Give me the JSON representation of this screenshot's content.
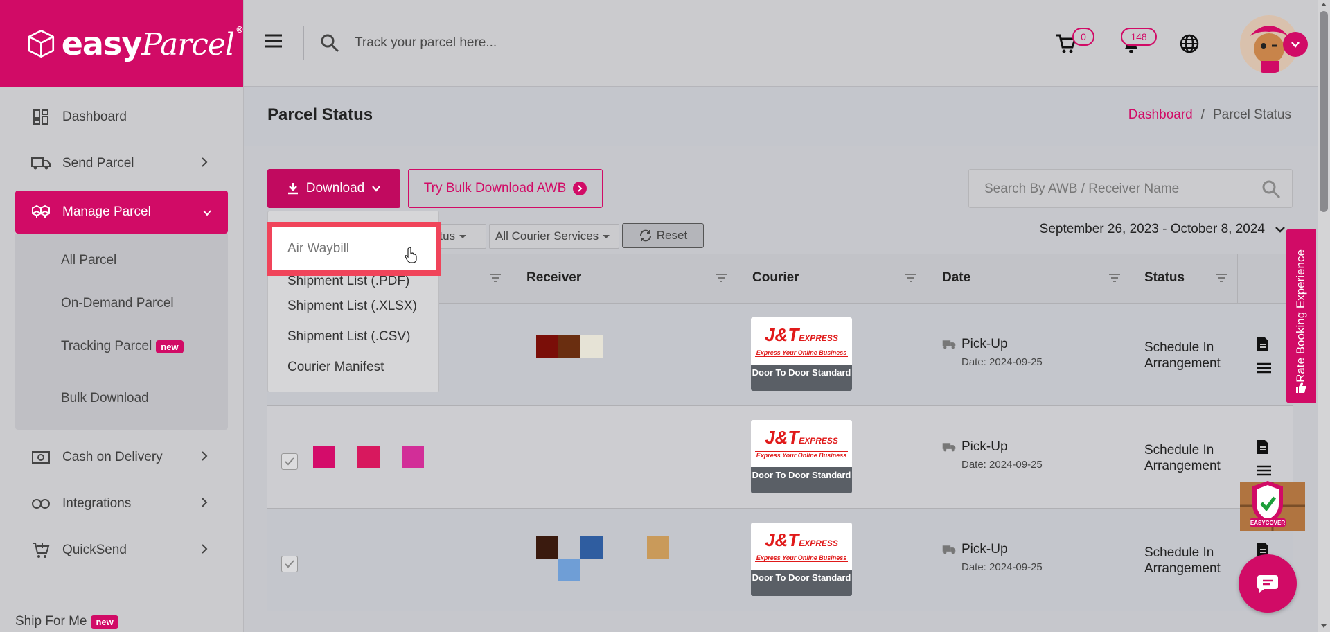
{
  "brand": {
    "name": "easy",
    "script": "Parcel",
    "reg": "®",
    "color": "#d10b66"
  },
  "topbar": {
    "track_placeholder": "Track your parcel here...",
    "cart_count": "0",
    "notification_count": "148"
  },
  "sidebar": {
    "items": [
      {
        "label": "Dashboard",
        "icon": "dashboard-icon"
      },
      {
        "label": "Send Parcel",
        "icon": "truck-icon"
      },
      {
        "label": "Manage Parcel",
        "icon": "boxes-icon"
      },
      {
        "label": "Cash on Delivery",
        "icon": "cash-icon"
      },
      {
        "label": "Integrations",
        "icon": "link-icon"
      },
      {
        "label": "QuickSend",
        "icon": "cart-plus-icon"
      }
    ],
    "sub_items": [
      {
        "label": "All Parcel"
      },
      {
        "label": "On-Demand Parcel"
      },
      {
        "label": "Tracking Parcel",
        "badge": "new"
      },
      {
        "label": "Bulk Download"
      }
    ],
    "ship_for_me": {
      "label": "Ship For Me",
      "badge": "new"
    }
  },
  "page": {
    "title": "Parcel Status",
    "breadcrumb": {
      "home": "Dashboard",
      "sep": "/",
      "current": "Parcel Status"
    }
  },
  "toolbar": {
    "download_label": "Download",
    "bulk_label": "Try Bulk Download AWB",
    "search_placeholder": "Search By AWB / Receiver Name",
    "filter_status": "atus",
    "filter_courier": "All Courier Services",
    "reset_label": "Reset",
    "date_range": "September 26, 2023 - October 8, 2024"
  },
  "dropdown": {
    "items": [
      "Air Waybill",
      "Shipment List (.PDF)",
      "Shipment List (.XLSX)",
      "Shipment List (.CSV)",
      "Courier Manifest"
    ]
  },
  "table": {
    "headers": [
      "Receiver",
      "Courier",
      "Date",
      "Status"
    ],
    "rows": [
      {
        "courier_name": "J&T",
        "courier_suffix": "EXPRESS",
        "courier_tagline": "Express Your Online Business",
        "service": "Door To Door Standard",
        "date_status": "Pick-Up",
        "date": "Date: 2024-09-25",
        "status": "Schedule In Arrangement",
        "swatches": [
          "#7a0e08",
          "#6a2e10",
          "#e6e3d6"
        ]
      },
      {
        "courier_name": "J&T",
        "courier_suffix": "EXPRESS",
        "courier_tagline": "Express Your Online Business",
        "service": "Door To Door Standard",
        "date_status": "Pick-Up",
        "date": "Date: 2024-09-25",
        "status": "Schedule In Arrangement",
        "swatches": [
          "#d40c6a",
          "#d8185e",
          "#d22e98"
        ]
      },
      {
        "courier_name": "J&T",
        "courier_suffix": "EXPRESS",
        "courier_tagline": "Express Your Online Business",
        "service": "Door To Door Standard",
        "date_status": "Pick-Up",
        "date": "Date: 2024-09-25",
        "status": "Schedule In Arrangement",
        "swatches": [
          "#3a1a0e",
          "#2f5da0",
          "#c99a5a",
          "#6f9ed6"
        ]
      }
    ]
  },
  "widgets": {
    "rate_label": "Rate Booking Experience",
    "easycover_label": "EASYCOVER"
  }
}
